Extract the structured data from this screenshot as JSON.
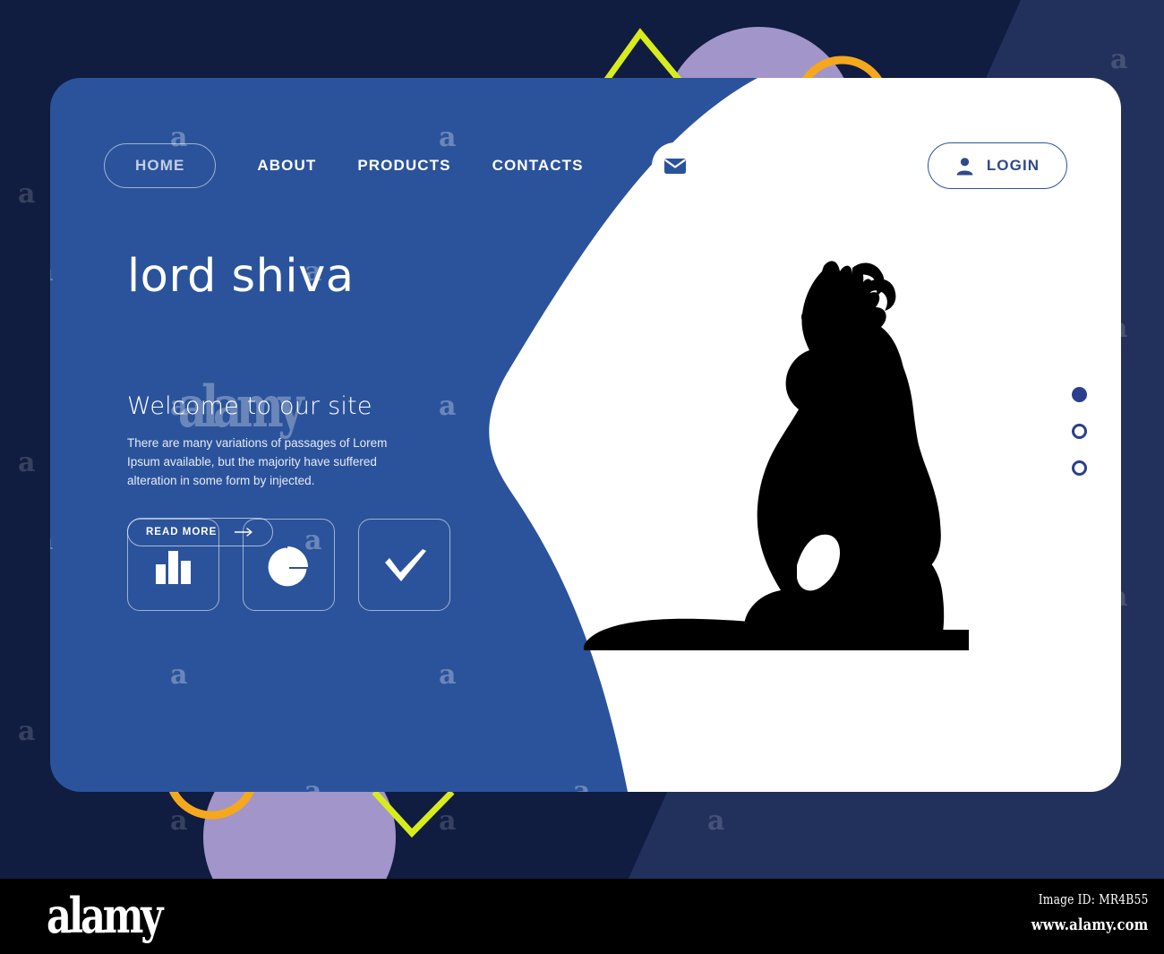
{
  "colors": {
    "backdrop_navy": "#101c40",
    "backdrop_navy_light": "#22305c",
    "panel_blue": "#2b539b",
    "white": "#ffffff",
    "accent_purple": "#a295c9",
    "accent_orange": "#f5a81c",
    "accent_lime": "#d8ec1c",
    "dot_blue": "#2b3f8f",
    "silhouette": "#000000"
  },
  "nav": {
    "items": [
      {
        "label": "HOME",
        "active": true
      },
      {
        "label": "ABOUT",
        "active": false
      },
      {
        "label": "PRODUCTS",
        "active": false
      },
      {
        "label": "CONTACTS",
        "active": false
      }
    ],
    "mail_icon": "envelope-icon"
  },
  "login": {
    "label": "LOGIN",
    "icon": "user-icon"
  },
  "hero": {
    "title": "lord shiva",
    "subtitle": "Welcome to our site",
    "body": "There are many variations of passages of Lorem Ipsum available, but the majority have suffered alteration in some form by injected.",
    "cta_label": "READ MORE",
    "cta_icon": "arrow-right-icon"
  },
  "features": [
    {
      "icon": "bar-chart-icon",
      "label": "Bar chart"
    },
    {
      "icon": "pie-chart-icon",
      "label": "Pie chart"
    },
    {
      "icon": "check-icon",
      "label": "Checkmark"
    }
  ],
  "carousel": {
    "dots": [
      {
        "active": true
      },
      {
        "active": false
      },
      {
        "active": false
      }
    ]
  },
  "illustration": {
    "name": "lord-shiva-silhouette"
  },
  "watermark": {
    "letter": "a",
    "wordmark": "alamy"
  },
  "footer": {
    "logo": "alamy",
    "image_id": "Image ID: MR4B55",
    "url": "www.alamy.com"
  }
}
